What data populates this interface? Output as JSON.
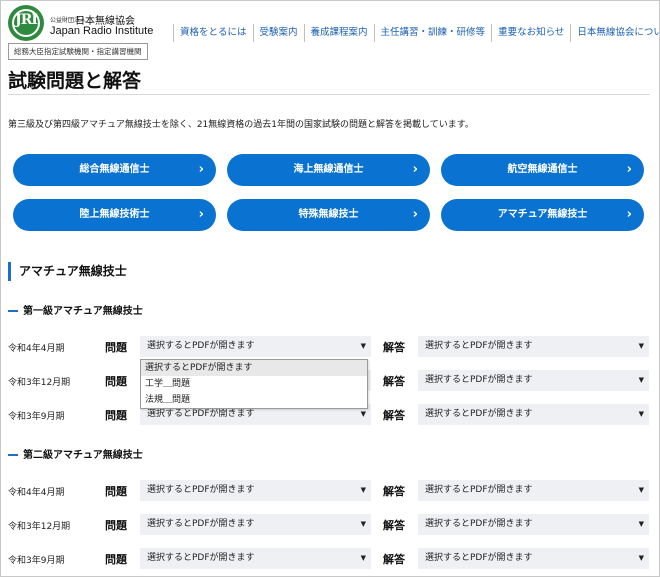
{
  "header": {
    "org_type": "公益財団法人",
    "org_name_jp": "日本無線協会",
    "org_name_en": "Japan Radio Institute",
    "badge": "総務大臣指定試験機関・指定講習機関",
    "nav": [
      "資格をとるには",
      "受験案内",
      "養成課程案内",
      "主任講習・訓練・研修等",
      "重要なお知らせ",
      "日本無線協会について"
    ]
  },
  "page": {
    "title": "試験問題と解答",
    "lead": "第三級及び第四級アマチュア無線技士を除く、21無線資格の過去1年間の国家試験の問題と解答を掲載しています。"
  },
  "categories": [
    "総合無線通信士",
    "海上無線通信士",
    "航空無線通信士",
    "陸上無線技術士",
    "特殊無線技士",
    "アマチュア無線技士"
  ],
  "section": {
    "title": "アマチュア無線技士",
    "problem_label": "問題",
    "answer_label": "解答",
    "placeholder": "選択するとPDFが開きます",
    "groups": [
      {
        "title": "第一級アマチュア無線技士",
        "rows": [
          "令和4年4月期",
          "令和3年12月期",
          "令和3年9月期"
        ]
      },
      {
        "title": "第二級アマチュア無線技士",
        "rows": [
          "令和4年4月期",
          "令和3年12月期",
          "令和3年9月期"
        ]
      }
    ]
  },
  "dropdown": {
    "options": [
      "選択するとPDFが開きます",
      "工学＿問題",
      "法規＿問題"
    ],
    "highlighted": 0
  },
  "colors": {
    "accent": "#0a73d1",
    "logo": "#2d8a3e",
    "field_bg": "#eef0f3"
  },
  "icons": {
    "chevron": "chevron-right-icon",
    "select_arrow": "triangle-down-icon"
  }
}
